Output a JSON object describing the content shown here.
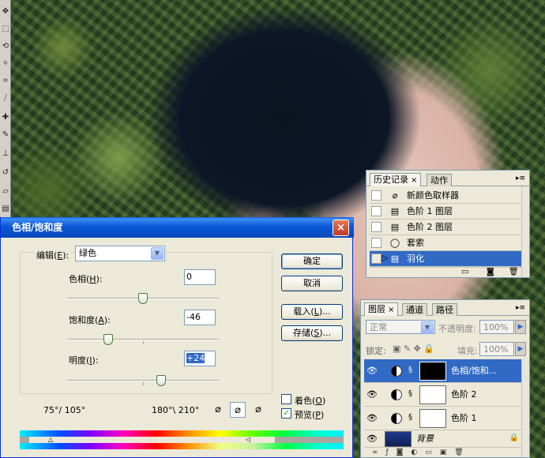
{
  "history_panel": {
    "tabs": [
      {
        "label": "历史记录",
        "close": "×"
      },
      {
        "label": "动作"
      }
    ],
    "items": [
      {
        "label": "新颜色取样器",
        "icon": "eyedropper-icon"
      },
      {
        "label": "色阶 1 图层",
        "icon": "layer-icon"
      },
      {
        "label": "色阶 2 图层",
        "icon": "layer-icon"
      },
      {
        "label": "套索",
        "icon": "lasso-icon"
      },
      {
        "label": "羽化",
        "icon": "layer-icon",
        "selected": true
      }
    ]
  },
  "layers_panel": {
    "tabs": [
      {
        "label": "图层",
        "close": "×"
      },
      {
        "label": "通道"
      },
      {
        "label": "路径"
      }
    ],
    "blend_mode": "正常",
    "opacity_label": "不透明度:",
    "opacity_value": "100%",
    "lock_label": "锁定:",
    "fill_label": "填充:",
    "fill_value": "100%",
    "layers": [
      {
        "name": "色相/饱和...",
        "selected": true
      },
      {
        "name": "色阶 2"
      },
      {
        "name": "色阶 1"
      },
      {
        "name": "背景"
      }
    ]
  },
  "dialog": {
    "title": "色相/饱和度",
    "close": "×",
    "edit_label": "编辑",
    "edit_key": "E",
    "edit_value": "绿色",
    "hue": {
      "label": "色相",
      "key": "H",
      "value": "0",
      "slider": 0.5
    },
    "saturation": {
      "label": "饱和度",
      "key": "A",
      "value": "-46",
      "slider": 0.27
    },
    "lightness": {
      "label": "明度",
      "key": "I",
      "value": "+24",
      "slider": 0.62
    },
    "buttons": {
      "ok": "确定",
      "cancel": "取消",
      "load": "载入",
      "load_key": "L",
      "save": "存储",
      "save_key": "S",
      "ellipsis": "..."
    },
    "colorize": {
      "label": "着色",
      "key": "O",
      "checked": false
    },
    "preview": {
      "label": "预览",
      "key": "P",
      "checked": true
    },
    "range_left": "75°/ 105°",
    "range_right": "180°\\ 210°"
  }
}
